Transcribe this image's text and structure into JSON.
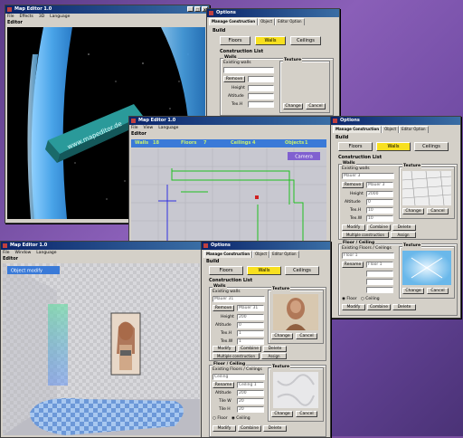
{
  "editor1": {
    "title": "Map Editor 1.0",
    "menu": [
      "File",
      "Effects",
      "3D",
      "Language"
    ],
    "panel": "Editor",
    "banner": "www.mapeditor.de"
  },
  "options1": {
    "title": "Options",
    "tabs": [
      "Manage Construction",
      "Object",
      "Editor Option"
    ],
    "build": "Build",
    "buttons": [
      "Floors",
      "Walls",
      "Ceilings"
    ],
    "cl": "Construction List",
    "walls": "Walls",
    "existing": "Existing walls",
    "texture": "Texture",
    "fields": [
      "Remove",
      "Height",
      "Altitude",
      "Tex.H",
      "Tile W"
    ],
    "change": "Change",
    "cancel": "Cancel"
  },
  "editor2": {
    "title": "Map Editor 1.0",
    "menu": [
      "File",
      "View",
      "Language"
    ],
    "panel": "Editor",
    "stats": [
      {
        "k": "Walls",
        "v": "18"
      },
      {
        "k": "Floors",
        "v": "7"
      },
      {
        "k": "Ceilings",
        "v": "4"
      },
      {
        "k": "Objects",
        "v": "1"
      }
    ],
    "btn": "Camera"
  },
  "options2": {
    "title": "Options",
    "tabs": [
      "Manage Construction",
      "Object",
      "Editor Option"
    ],
    "build": "Build",
    "buttons": [
      "Floors",
      "Walls",
      "Ceilings"
    ],
    "cl": "Construction List",
    "walls": "Walls",
    "existing": "Existing walls",
    "wallsel": "Mauer 3",
    "remove": "Remove",
    "remove_val": "Mauer 3",
    "height": "Height",
    "height_val": "2000",
    "altitude": "Altitude",
    "altitude_val": "0",
    "texh": "Tex.H",
    "texh_val": "10",
    "texw": "Tex.W",
    "texw_val": "10",
    "texture": "Texture",
    "change": "Change",
    "cancel": "Cancel",
    "modify": "Modify",
    "combine": "Combine",
    "delete": "Delete",
    "multi_construction": "Multiple construction",
    "multi_assign": "Assign",
    "floor_title": "Floor / Ceiling",
    "existing_fc": "Existing Floors / Ceilings",
    "fcsel": "Floor 1",
    "rename": "Rename",
    "rename_val": "Floor 1",
    "floor": "Floor",
    "ceiling": "Ceiling",
    "modify2": "Modify",
    "combine2": "Combine",
    "delete2": "Delete",
    "multi_construction2": "Multiple construction",
    "assign2": "Assign"
  },
  "editor3": {
    "title": "Map Editor 1.0",
    "menu": [
      "File",
      "Window",
      "Language"
    ],
    "panel": "Editor",
    "modify": "Object modify"
  },
  "options3": {
    "title": "Options",
    "tabs": [
      "Manage Construction",
      "Object",
      "Editor Option"
    ],
    "build": "Build",
    "buttons": [
      "Floors",
      "Walls",
      "Ceilings"
    ],
    "cl": "Construction List",
    "walls": "Walls",
    "existing": "Existing walls",
    "wallsel": "Mauer 31",
    "remove": "Remove",
    "remove_val": "Mauer 31",
    "height": "Height",
    "height_val": "200",
    "altitude": "Altitude",
    "altitude_val": "0",
    "texh": "Tex.H",
    "texh_val": "1",
    "texw": "Tex.W",
    "texw_val": "1",
    "texture": "Texture",
    "change": "Change",
    "cancel": "Cancel",
    "modify": "Modify",
    "combine": "Combine",
    "delete": "Delete",
    "multi_construction": "Multiple construction",
    "multi_assign": "Assign",
    "floor_title": "Floor / Ceiling",
    "existing_fc": "Existing Floors / Ceilings",
    "fcsel": "Ceiling",
    "rename": "Rename",
    "rename_val": "Ceiling 1",
    "altitude2": "Altitude",
    "altitude2_val": "200",
    "tilew": "Tile W",
    "tilew_val": "20",
    "tileh": "Tile H",
    "tileh_val": "20",
    "floor": "Floor",
    "ceiling": "Ceiling",
    "modify2": "Modify",
    "combine2": "Combine",
    "delete2": "Delete"
  }
}
